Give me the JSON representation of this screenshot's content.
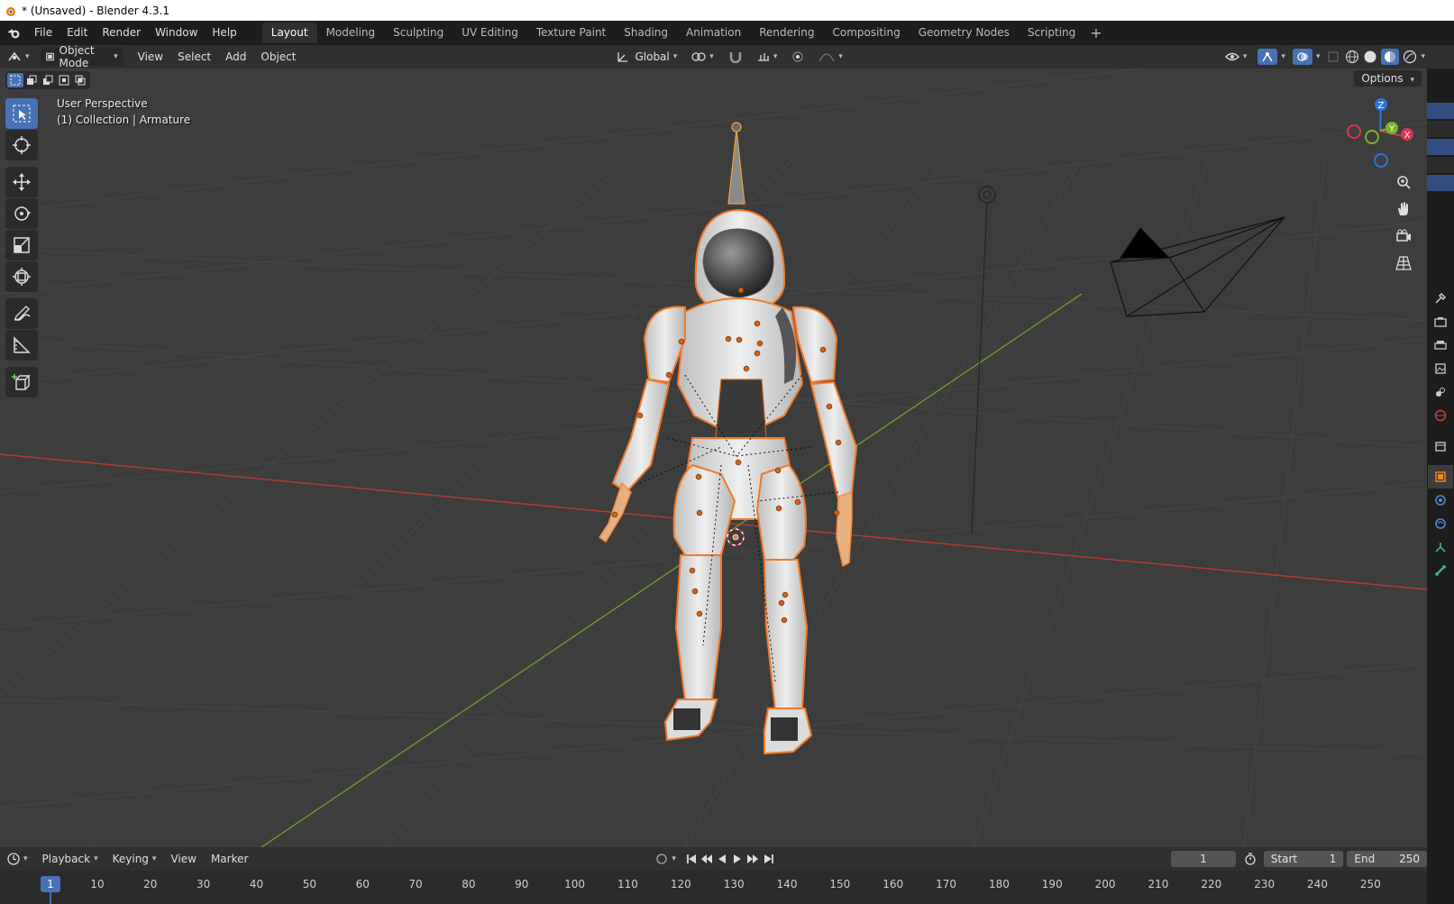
{
  "window": {
    "title": "* (Unsaved) - Blender 4.3.1"
  },
  "menu": {
    "items": [
      "File",
      "Edit",
      "Render",
      "Window",
      "Help"
    ]
  },
  "workspaces": {
    "tabs": [
      {
        "label": "Layout",
        "active": true
      },
      {
        "label": "Modeling",
        "active": false
      },
      {
        "label": "Sculpting",
        "active": false
      },
      {
        "label": "UV Editing",
        "active": false
      },
      {
        "label": "Texture Paint",
        "active": false
      },
      {
        "label": "Shading",
        "active": false
      },
      {
        "label": "Animation",
        "active": false
      },
      {
        "label": "Rendering",
        "active": false
      },
      {
        "label": "Compositing",
        "active": false
      },
      {
        "label": "Geometry Nodes",
        "active": false
      },
      {
        "label": "Scripting",
        "active": false
      }
    ],
    "add_label": "+"
  },
  "viewport_header": {
    "mode": "Object Mode",
    "menus": [
      "View",
      "Select",
      "Add",
      "Object"
    ],
    "transform_orientation": "Global",
    "options_label": "Options"
  },
  "viewport": {
    "perspective_label": "User Perspective",
    "collection_label": "(1) Collection | Armature",
    "gizmo_axes": {
      "x": "X",
      "y": "Y",
      "z": "Z"
    },
    "colors": {
      "background": "#3d3d3d",
      "grid": "#4a4a4a",
      "x_axis": "#b33a3a",
      "y_axis": "#6c9a2a",
      "selection_outline": "#f27a2a",
      "accent": "#4772b3"
    }
  },
  "tools": [
    {
      "name": "select-box-tool",
      "icon": "select-box-icon",
      "active": true
    },
    {
      "name": "cursor-tool",
      "icon": "cursor-icon",
      "active": false
    },
    {
      "name": "move-tool",
      "icon": "move-icon",
      "active": false
    },
    {
      "name": "rotate-tool",
      "icon": "rotate-icon",
      "active": false
    },
    {
      "name": "scale-tool",
      "icon": "scale-icon",
      "active": false
    },
    {
      "name": "transform-tool",
      "icon": "transform-icon",
      "active": false
    },
    {
      "name": "annotate-tool",
      "icon": "annotate-icon",
      "active": false
    },
    {
      "name": "measure-tool",
      "icon": "measure-icon",
      "active": false
    },
    {
      "name": "add-cube-tool",
      "icon": "add-cube-icon",
      "active": false
    }
  ],
  "timeline": {
    "menus": [
      "Playback",
      "Keying",
      "View",
      "Marker"
    ],
    "current_frame": "1",
    "start_label": "Start",
    "start_value": "1",
    "end_label": "End",
    "end_value": "250",
    "ruler": [
      "1",
      "10",
      "20",
      "30",
      "40",
      "50",
      "60",
      "70",
      "80",
      "90",
      "100",
      "110",
      "120",
      "130",
      "140",
      "150",
      "160",
      "170",
      "180",
      "190",
      "200",
      "210",
      "220",
      "230",
      "240",
      "250"
    ]
  }
}
